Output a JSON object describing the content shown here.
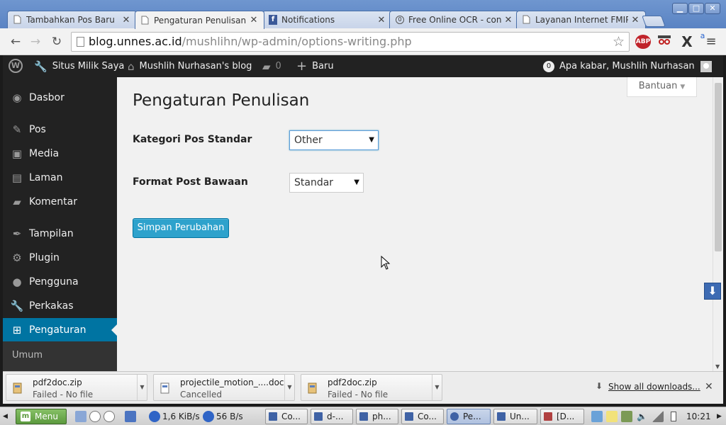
{
  "browser": {
    "tabs": [
      {
        "label": "Tambahkan Pos Baru",
        "active": false
      },
      {
        "label": "Pengaturan Penulisan",
        "active": true
      },
      {
        "label": "Notifications",
        "active": false
      },
      {
        "label": "Free Online OCR - con",
        "active": false
      },
      {
        "label": "Layanan Internet FMIP",
        "active": false
      }
    ],
    "url_host": "blog.unnes.ac.id",
    "url_path": "/mushlihn/wp-admin/options-writing.php",
    "extensions": {
      "abp": "ABP",
      "x": "X"
    }
  },
  "adminbar": {
    "site_link": "Situs Milik Saya",
    "blog_name": "Mushlih Nurhasan's blog",
    "comments_count": "0",
    "new_label": "Baru",
    "notif_count": "0",
    "greeting": "Apa kabar, Mushlih Nurhasan"
  },
  "sidebar": {
    "items": [
      {
        "label": "Dasbor",
        "icon": "dashboard-icon"
      },
      {
        "label": "Pos",
        "icon": "pin-icon"
      },
      {
        "label": "Media",
        "icon": "media-icon"
      },
      {
        "label": "Laman",
        "icon": "pages-icon"
      },
      {
        "label": "Komentar",
        "icon": "comment-icon"
      },
      {
        "label": "Tampilan",
        "icon": "brush-icon"
      },
      {
        "label": "Plugin",
        "icon": "plugin-icon"
      },
      {
        "label": "Pengguna",
        "icon": "user-icon"
      },
      {
        "label": "Perkakas",
        "icon": "wrench-icon"
      },
      {
        "label": "Pengaturan",
        "icon": "settings-icon",
        "current": true
      }
    ],
    "submenu": "Umum"
  },
  "content": {
    "help_tab": "Bantuan",
    "title": "Pengaturan Penulisan",
    "fields": [
      {
        "label": "Kategori Pos Standar",
        "value": "Other"
      },
      {
        "label": "Format Post Bawaan",
        "value": "Standar"
      }
    ],
    "save_button": "Simpan Perubahan"
  },
  "downloads": {
    "items": [
      {
        "name": "pdf2doc.zip",
        "status": "Failed - No file"
      },
      {
        "name": "projectile_motion_....doc",
        "status": "Cancelled"
      },
      {
        "name": "pdf2doc.zip",
        "status": "Failed - No file"
      }
    ],
    "show_all": "Show all downloads..."
  },
  "taskbar": {
    "menu_label": "Menu",
    "net_down": "1,6 KiB/s",
    "net_up": "56 B/s",
    "tasks": [
      {
        "label": "Co..."
      },
      {
        "label": "d-..."
      },
      {
        "label": "ph..."
      },
      {
        "label": "Co..."
      },
      {
        "label": "Pe...",
        "active": true
      },
      {
        "label": "Un..."
      },
      {
        "label": "[D..."
      }
    ],
    "clock": "10:21"
  }
}
